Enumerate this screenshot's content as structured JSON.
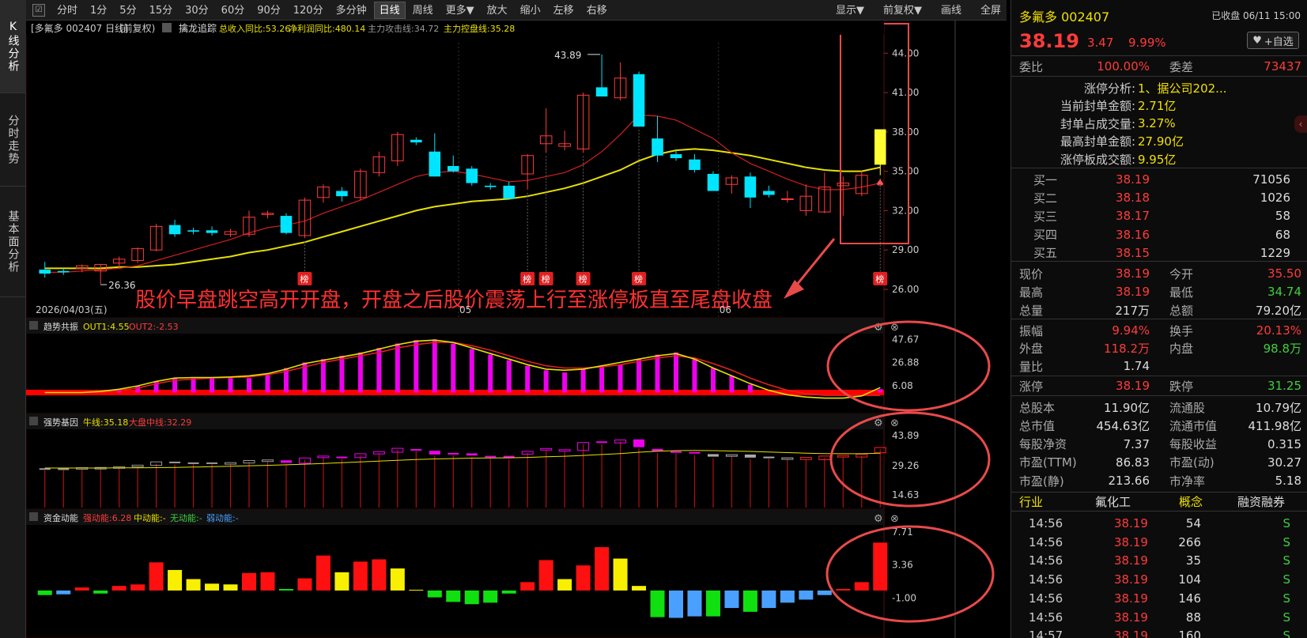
{
  "sidebar": {
    "tabs": [
      "K线分析",
      "分时走势",
      "基本面分析"
    ]
  },
  "toolbar": {
    "periods": [
      "分时",
      "1分",
      "5分",
      "15分",
      "30分",
      "60分",
      "90分",
      "120分",
      "多分钟",
      "日线",
      "周线",
      "更多▼",
      "放大",
      "缩小",
      "左移",
      "右移"
    ],
    "selected": "日线",
    "right_items": [
      "显示▼",
      "前复权▼",
      "画线",
      "全屏"
    ]
  },
  "main_panel": {
    "title": "[多氟多 002407 日线]",
    "adj": "(前复权)",
    "indicator_name": "擒龙追踪",
    "ind_values": [
      "总收入同比:53.26",
      "净利润同比:480.14",
      "主力攻击线:34.72",
      "主力控盘线:35.28"
    ],
    "y_ticks": [
      "44.00",
      "41.00",
      "38.00",
      "35.00",
      "32.00",
      "29.00",
      "26.00"
    ],
    "high_label": "43.89",
    "low_label": "26.36",
    "date_label": "2026/04/03(五)",
    "x_labels": [
      "05",
      "06"
    ],
    "bang_label": "榜",
    "annotation": "股价早盘跳空高开开盘，开盘之后股价震荡上行至涨停板直至尾盘收盘"
  },
  "sub1": {
    "name": "趋势共振",
    "out1": "OUT1:4.55",
    "out2": "OUT2:-2.53",
    "y_ticks": [
      "47.67",
      "26.88",
      "6.08"
    ]
  },
  "sub2": {
    "name": "强势基因",
    "v1": "牛线:35.18",
    "v2": "大盘中线:32.29",
    "y_ticks": [
      "43.89",
      "29.26",
      "14.63"
    ]
  },
  "sub3": {
    "name": "资金动能",
    "v1": "强动能:6.28",
    "v2": "中动能:-",
    "v3": "无动能:-",
    "v4": "弱动能:-",
    "y_ticks": [
      "7.71",
      "3.36",
      "-1.00"
    ]
  },
  "quote": {
    "name": "多氟多 002407",
    "status": "已收盘 06/11 15:00",
    "price": "38.19",
    "change": "3.47",
    "pct": "9.99%",
    "fav_button": "+自选",
    "weibi_label": "委比",
    "weibi": "100.00%",
    "weicha_label": "委差",
    "weicha": "73437",
    "limit_rows": [
      {
        "label": "涨停分析:",
        "value": "1、据公司202..."
      },
      {
        "label": "当前封单金额:",
        "value": "2.71亿"
      },
      {
        "label": "封单占成交量:",
        "value": "3.27%"
      },
      {
        "label": "最高封单金额:",
        "value": "27.90亿"
      },
      {
        "label": "涨停板成交额:",
        "value": "9.95亿"
      }
    ],
    "bids": [
      {
        "label": "买一",
        "price": "38.19",
        "vol": "71056"
      },
      {
        "label": "买二",
        "price": "38.18",
        "vol": "1026"
      },
      {
        "label": "买三",
        "price": "38.17",
        "vol": "58"
      },
      {
        "label": "买四",
        "price": "38.16",
        "vol": "68"
      },
      {
        "label": "买五",
        "price": "38.15",
        "vol": "1229"
      }
    ],
    "stats": [
      {
        "l1": "现价",
        "v1": "38.19",
        "l2": "今开",
        "v2": "35.50"
      },
      {
        "l1": "最高",
        "v1": "38.19",
        "l2": "最低",
        "v2": "34.74"
      },
      {
        "l1": "总量",
        "v1": "217万",
        "l2": "总额",
        "v2": "79.20亿"
      }
    ],
    "stats2": [
      {
        "l1": "振幅",
        "v1": "9.94%",
        "l2": "换手",
        "v2": "20.13%"
      },
      {
        "l1": "外盘",
        "v1": "118.2万",
        "l2": "内盘",
        "v2": "98.8万"
      },
      {
        "l1": "量比",
        "v1": "1.74",
        "l2": "",
        "v2": ""
      }
    ],
    "limits": {
      "l1": "涨停",
      "v1": "38.19",
      "l2": "跌停",
      "v2": "31.25"
    },
    "fundamentals": [
      {
        "l1": "总股本",
        "v1": "11.90亿",
        "l2": "流通股",
        "v2": "10.79亿"
      },
      {
        "l1": "总市值",
        "v1": "454.63亿",
        "l2": "流通市值",
        "v2": "411.98亿"
      },
      {
        "l1": "每股净资",
        "v1": "7.37",
        "l2": "每股收益",
        "v2": "0.315"
      },
      {
        "l1": "市盈(TTM)",
        "v1": "86.83",
        "l2": "市盈(动)",
        "v2": "30.27"
      },
      {
        "l1": "市盈(静)",
        "v1": "213.66",
        "l2": "市净率",
        "v2": "5.18"
      }
    ],
    "tags": [
      "行业",
      "氟化工",
      "概念",
      "融资融券"
    ],
    "ticks": [
      {
        "time": "14:56",
        "price": "38.19",
        "vol": "54",
        "side": "S"
      },
      {
        "time": "14:56",
        "price": "38.19",
        "vol": "266",
        "side": "S"
      },
      {
        "time": "14:56",
        "price": "38.19",
        "vol": "35",
        "side": "S"
      },
      {
        "time": "14:56",
        "price": "38.19",
        "vol": "104",
        "side": "S"
      },
      {
        "time": "14:56",
        "price": "38.19",
        "vol": "146",
        "side": "S"
      },
      {
        "time": "14:56",
        "price": "38.19",
        "vol": "88",
        "side": "S"
      },
      {
        "time": "14:57",
        "price": "38.19",
        "vol": "160",
        "side": "S"
      }
    ]
  },
  "chart_data": [
    {
      "type": "candlestick",
      "ylim": [
        26,
        44.8
      ],
      "ohlc": [
        [
          27.5,
          28.1,
          26.9,
          27.2
        ],
        [
          27.4,
          27.6,
          27.1,
          27.3
        ],
        [
          27.6,
          27.9,
          27.3,
          27.8
        ],
        [
          27.4,
          27.9,
          26.4,
          27.9
        ],
        [
          28.0,
          28.5,
          27.6,
          28.3
        ],
        [
          28.2,
          29.2,
          28.0,
          29.1
        ],
        [
          29.0,
          31.0,
          28.9,
          30.8
        ],
        [
          30.9,
          31.3,
          30.0,
          30.2
        ],
        [
          30.5,
          30.7,
          30.2,
          30.4
        ],
        [
          30.5,
          30.8,
          30.1,
          30.3
        ],
        [
          30.2,
          30.6,
          30.0,
          30.4
        ],
        [
          30.2,
          32.0,
          30.0,
          31.5
        ],
        [
          31.7,
          32.0,
          31.4,
          31.8
        ],
        [
          31.6,
          31.8,
          30.2,
          30.3
        ],
        [
          30.1,
          33.0,
          29.9,
          32.8
        ],
        [
          33.0,
          34.0,
          32.6,
          33.8
        ],
        [
          33.5,
          33.8,
          32.7,
          33.1
        ],
        [
          33.0,
          35.2,
          32.8,
          35.0
        ],
        [
          34.9,
          36.5,
          34.6,
          36.1
        ],
        [
          35.8,
          38.0,
          35.4,
          37.8
        ],
        [
          37.4,
          37.6,
          37.0,
          37.2
        ],
        [
          36.5,
          37.9,
          34.6,
          34.6
        ],
        [
          35.4,
          36.2,
          34.9,
          35.0
        ],
        [
          35.2,
          35.4,
          33.9,
          34.1
        ],
        [
          33.9,
          34.1,
          33.6,
          33.8
        ],
        [
          33.9,
          34.2,
          32.9,
          32.9
        ],
        [
          34.8,
          36.3,
          33.6,
          36.2
        ],
        [
          37.1,
          39.8,
          36.4,
          37.7
        ],
        [
          36.9,
          38.1,
          36.6,
          37.1
        ],
        [
          36.7,
          41.0,
          36.4,
          40.8
        ],
        [
          41.4,
          43.9,
          40.9,
          40.7
        ],
        [
          40.6,
          43.3,
          40.4,
          42.1
        ],
        [
          42.4,
          42.6,
          38.4,
          38.4
        ],
        [
          37.5,
          39.2,
          35.7,
          36.2
        ],
        [
          36.3,
          36.6,
          35.8,
          36.0
        ],
        [
          35.9,
          36.3,
          34.9,
          35.1
        ],
        [
          34.8,
          35.0,
          33.5,
          33.5
        ],
        [
          34.0,
          34.7,
          33.3,
          34.5
        ],
        [
          34.6,
          34.9,
          32.2,
          33.0
        ],
        [
          33.5,
          33.9,
          33.0,
          33.2
        ],
        [
          32.9,
          33.5,
          32.6,
          32.9
        ],
        [
          32.0,
          34.0,
          31.6,
          33.1
        ],
        [
          31.9,
          34.9,
          31.8,
          33.8
        ],
        [
          33.9,
          34.6,
          31.6,
          34.1
        ],
        [
          33.3,
          35.0,
          33.1,
          34.7
        ],
        [
          35.5,
          38.2,
          34.7,
          38.2
        ]
      ],
      "ma_short": [
        27.3,
        27.3,
        27.4,
        27.5,
        27.6,
        27.8,
        28.2,
        28.6,
        29.0,
        29.4,
        29.8,
        30.3,
        30.7,
        30.9,
        31.2,
        31.8,
        32.3,
        32.8,
        33.4,
        34.0,
        34.6,
        34.9,
        35.0,
        34.8,
        34.5,
        34.2,
        34.3,
        34.6,
        34.9,
        35.5,
        36.5,
        37.8,
        39.3,
        39.2,
        38.9,
        38.2,
        37.5,
        36.4,
        35.6,
        35.0,
        34.4,
        33.9,
        33.6,
        33.6,
        33.8,
        34.1
      ],
      "ma_long": [
        27.6,
        27.6,
        27.6,
        27.6,
        27.7,
        27.7,
        27.8,
        27.9,
        28.1,
        28.3,
        28.5,
        28.8,
        29.0,
        29.3,
        29.6,
        30.0,
        30.4,
        30.8,
        31.2,
        31.6,
        32.0,
        32.3,
        32.5,
        32.7,
        32.8,
        32.9,
        33.1,
        33.4,
        33.7,
        34.1,
        34.6,
        35.1,
        35.8,
        36.3,
        36.6,
        36.7,
        36.6,
        36.4,
        36.2,
        35.9,
        35.6,
        35.3,
        35.1,
        35.0,
        35.0,
        35.3
      ],
      "bang_positions": [
        14,
        26,
        27,
        29,
        32,
        45
      ]
    },
    {
      "type": "bar",
      "name": "趋势共振",
      "ylim": [
        -2,
        50
      ],
      "values": [
        0,
        0,
        0,
        0,
        3,
        6,
        10,
        13,
        13,
        13,
        13,
        13,
        16,
        22,
        27,
        30,
        33,
        36,
        40,
        44,
        47,
        47.7,
        44,
        39,
        34,
        29,
        24,
        20,
        18,
        21,
        24,
        25,
        30,
        34,
        36,
        30,
        22,
        15,
        7,
        0,
        0,
        0,
        0,
        0,
        0,
        3
      ],
      "line1": [
        0,
        0,
        0,
        1,
        3,
        6,
        10,
        13,
        13.5,
        13.5,
        14,
        15,
        17,
        21,
        26,
        29,
        32,
        35,
        39,
        43,
        46,
        47,
        45,
        40,
        35,
        30,
        25,
        21,
        20,
        21,
        24,
        27,
        30,
        33,
        35,
        30,
        22,
        15,
        8,
        2,
        -2,
        -4,
        -5,
        -5,
        -3,
        4.5
      ],
      "line2": [
        0,
        0,
        0,
        0,
        2,
        4,
        8,
        11,
        12,
        13,
        13.5,
        14,
        16,
        19,
        23,
        27,
        30,
        33,
        36,
        40,
        43,
        45,
        45,
        42,
        38,
        33,
        28,
        24,
        22,
        22,
        23,
        25,
        28,
        31,
        33,
        31,
        26,
        20,
        13,
        7,
        2,
        -1,
        -2.5,
        -2.5,
        -2.5,
        -2.5
      ]
    },
    {
      "type": "bar",
      "name": "资金动能",
      "ylim": [
        -5,
        8
      ],
      "values": [
        -0.6,
        -0.5,
        0.4,
        -0.4,
        0.6,
        0.8,
        3.7,
        2.7,
        1.5,
        0.9,
        0.8,
        2.3,
        2.4,
        0.2,
        1.6,
        4.6,
        2.4,
        3.8,
        4.1,
        2.9,
        0.1,
        -0.9,
        -1.5,
        -1.8,
        -1.6,
        -0.4,
        1.1,
        4.0,
        1.5,
        3.3,
        5.7,
        4.2,
        0.6,
        -3.5,
        -3.6,
        -3.4,
        -3.4,
        -2.3,
        -2.8,
        -2.3,
        -1.6,
        -1.2,
        -0.6,
        0.2,
        1.1,
        6.3
      ],
      "colors": [
        "g",
        "b",
        "r",
        "g",
        "r",
        "r",
        "r",
        "y",
        "y",
        "y",
        "y",
        "r",
        "r",
        "g",
        "r",
        "r",
        "y",
        "r",
        "r",
        "y",
        "y",
        "g",
        "g",
        "g",
        "g",
        "g",
        "r",
        "r",
        "y",
        "r",
        "r",
        "y",
        "y",
        "g",
        "b",
        "b",
        "g",
        "b",
        "g",
        "b",
        "b",
        "b",
        "b",
        "r",
        "r",
        "r"
      ]
    }
  ]
}
